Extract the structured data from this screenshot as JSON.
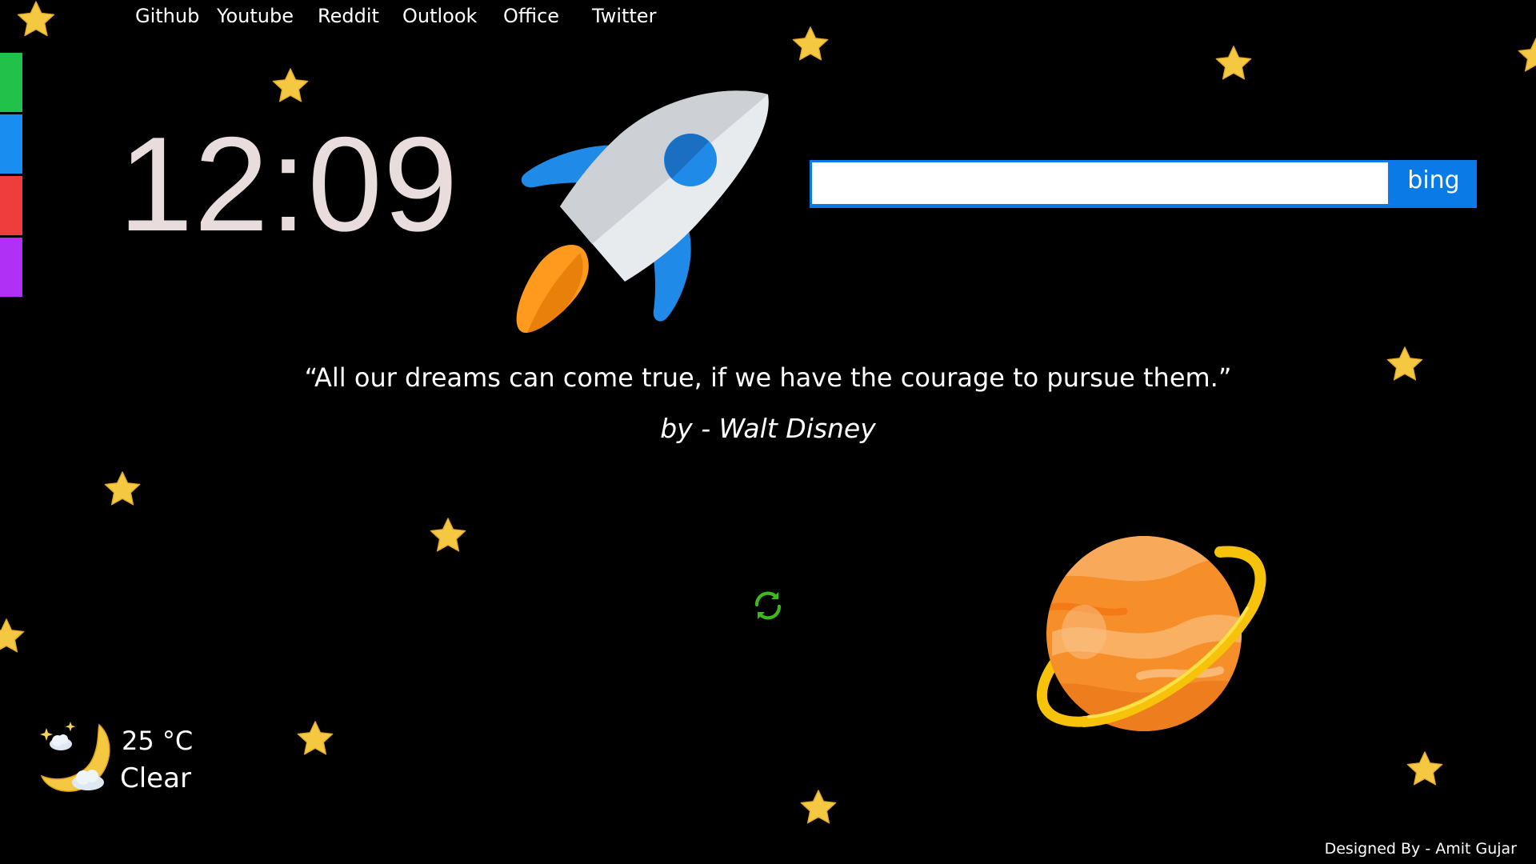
{
  "nav": {
    "links": [
      {
        "label": "Github"
      },
      {
        "label": "Youtube"
      },
      {
        "label": "Reddit"
      },
      {
        "label": "Outlook"
      },
      {
        "label": "Office"
      },
      {
        "label": "Twitter"
      }
    ]
  },
  "side_palette": {
    "colors": [
      "#22c14a",
      "#1a8ef0",
      "#ef3d3d",
      "#b030f5"
    ]
  },
  "clock": {
    "time": "12:09"
  },
  "search": {
    "value": "",
    "button_label": "bing",
    "accent_color": "#0a7be6"
  },
  "quote": {
    "text": "“All our dreams can come true, if we have the courage to pursue them.”",
    "author": "by - Walt Disney"
  },
  "weather": {
    "icon": "moon-cloud-icon",
    "temperature": "25 °C",
    "condition": "Clear"
  },
  "footer": {
    "credit": "Designed By - Amit Gujar"
  },
  "decorations": {
    "star_color": "#f5c842",
    "rocket": "rocket-icon",
    "planet": "planet-icon",
    "refresh": "refresh-icon"
  }
}
